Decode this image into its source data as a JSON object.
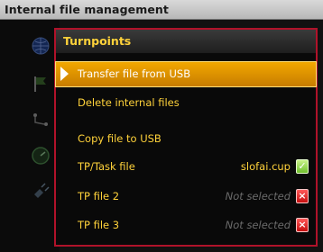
{
  "window": {
    "title": "Internal file management"
  },
  "menu": {
    "header": "Turnpoints",
    "items": [
      {
        "label": "Transfer file from USB",
        "selected": true
      },
      {
        "label": "Delete internal files"
      },
      {
        "label": "Copy file to USB"
      },
      {
        "label": "TP/Task file",
        "value": "slofai.cup",
        "status": "ok"
      },
      {
        "label": "TP file 2",
        "value": "Not selected",
        "status": "none"
      },
      {
        "label": "TP file 3",
        "value": "Not selected",
        "status": "none"
      }
    ]
  },
  "icons": {
    "ok": "document-ok-icon",
    "none": "cancel-icon",
    "side": [
      "globe-icon",
      "flag-icon",
      "route-icon",
      "gauge-icon",
      "satellite-icon"
    ]
  },
  "colors": {
    "accent": "#ffd23a",
    "selected": "#f2a800",
    "border": "#b0122a",
    "dim": "#6b6b6b"
  }
}
